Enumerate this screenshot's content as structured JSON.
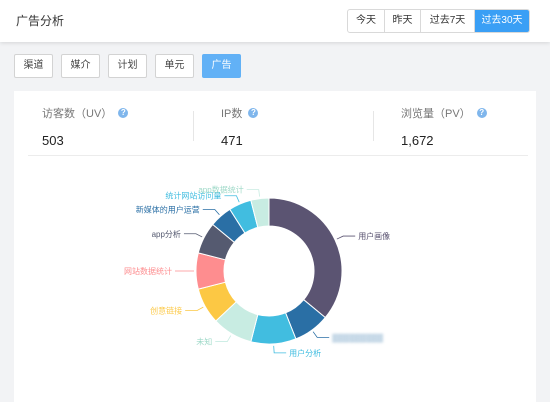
{
  "header": {
    "title": "广告分析",
    "ranges": [
      "今天",
      "昨天",
      "过去7天",
      "过去30天"
    ],
    "active_range": "过去30天"
  },
  "filters": {
    "items": [
      "渠道",
      "媒介",
      "计划",
      "单元",
      "广告"
    ],
    "active": "广告"
  },
  "metrics": [
    {
      "label": "访客数（UV）",
      "value": "503"
    },
    {
      "label": "IP数",
      "value": "471"
    },
    {
      "label": "浏览量（PV）",
      "value": "1,672"
    }
  ],
  "colors": {
    "accent": "#3a9ff5",
    "help_icon": "#7fb6ec"
  },
  "chart_data": {
    "type": "pie",
    "donut": true,
    "slices": [
      {
        "label": "用户画像",
        "value": 36.0,
        "color": "#5b5472"
      },
      {
        "label": "▒▒▒▒▒▒▒▒▒",
        "value": 8.0,
        "color": "#2a6fa5"
      },
      {
        "label": "用户分析",
        "value": 10.0,
        "color": "#41bde0"
      },
      {
        "label": "未知",
        "value": 9.0,
        "color": "#c8ece2"
      },
      {
        "label": "创意链接",
        "value": 8.0,
        "color": "#fcc844"
      },
      {
        "label": "网站数据统计",
        "value": 8.0,
        "color": "#fe8d8f"
      },
      {
        "label": "app分析",
        "value": 7.0,
        "color": "#555a70"
      },
      {
        "label": "新媒体的用户运营",
        "value": 5.0,
        "color": "#2a6fa5"
      },
      {
        "label": "统计网站访问量",
        "value": 5.0,
        "color": "#41bde0"
      },
      {
        "label": "app数据统计",
        "value": 4.0,
        "color": "#c8ece2"
      }
    ]
  }
}
